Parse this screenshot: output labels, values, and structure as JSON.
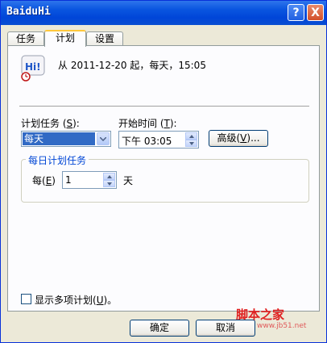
{
  "window": {
    "title": "BaiduHi"
  },
  "titlebar_buttons": {
    "help": "?",
    "close": "X"
  },
  "tabs": [
    {
      "label": "任务",
      "active": false
    },
    {
      "label": "计划",
      "active": true
    },
    {
      "label": "设置",
      "active": false
    }
  ],
  "summary": {
    "icon_text": "Hi!",
    "text": "从 2011-12-20 起，每天，15:05"
  },
  "schedule_task": {
    "label_main": "计划任务 (",
    "label_key": "S",
    "label_end": "):",
    "value": "每天"
  },
  "start_time": {
    "label_main": "开始时间 (",
    "label_key": "T",
    "label_end": "):",
    "value": "下午 03:05"
  },
  "advanced_button": {
    "label_main": "高级(",
    "label_key": "V",
    "label_end": ")..."
  },
  "daily_group": {
    "title": "每日计划任务",
    "every_label_main": "每(",
    "every_label_key": "E",
    "every_label_end": ")",
    "every_value": "1",
    "unit": "天"
  },
  "show_multiple": {
    "label_main": "显示多项计划(",
    "label_key": "U",
    "label_end": ")。",
    "checked": false
  },
  "buttons": {
    "ok": "确定",
    "cancel": "取消"
  },
  "watermark": {
    "brand": "脚本之家",
    "url": "www.jb51.net"
  },
  "colors": {
    "titlebar": "#0a56e0",
    "selection": "#316ac5",
    "group_title": "#0046d5",
    "watermark": "#e02020"
  }
}
